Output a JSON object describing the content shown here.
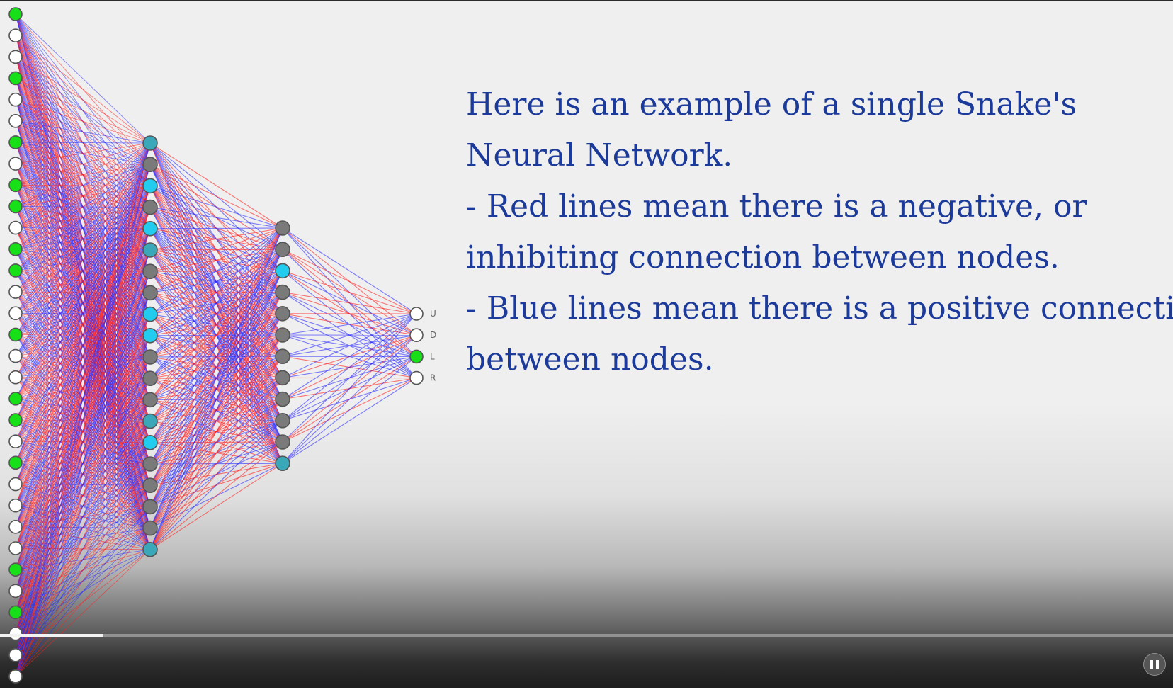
{
  "caption": {
    "line1": "Here is an example of a single Snake's",
    "line2": "Neural Network.",
    "line3": "- Red lines mean there is a negative, or",
    "line4": "inhibiting connection between nodes.",
    "line5": "- Blue lines mean there is a positive connection",
    "line6": "between nodes."
  },
  "network": {
    "layers": [
      {
        "name": "input",
        "active": [
          1,
          0,
          0,
          1,
          0,
          0,
          1,
          0,
          1,
          1,
          0,
          1,
          1,
          0,
          0,
          1,
          0,
          0,
          1,
          1,
          0,
          1,
          0,
          0,
          0,
          0,
          1,
          0,
          1,
          0,
          0,
          0
        ]
      },
      {
        "name": "hidden-1",
        "state": [
          "teal",
          "gray",
          "cyan",
          "gray",
          "cyan",
          "teal",
          "gray",
          "gray",
          "cyan",
          "cyan",
          "gray",
          "gray",
          "gray",
          "teal",
          "cyan",
          "gray",
          "gray",
          "gray",
          "gray",
          "teal"
        ]
      },
      {
        "name": "hidden-2",
        "state": [
          "gray",
          "gray",
          "cyan",
          "gray",
          "gray",
          "gray",
          "gray",
          "gray",
          "gray",
          "gray",
          "gray",
          "teal"
        ]
      },
      {
        "name": "output",
        "active": [
          0,
          0,
          1,
          0
        ],
        "labels": [
          "U",
          "D",
          "L",
          "R"
        ]
      }
    ],
    "colors": {
      "negative": "#ff2020",
      "positive": "#2a2aff",
      "active": "#18e018",
      "inactive": "#ffffff",
      "hidden_gray": "#7a7a7a",
      "hidden_cyan": "#22ccee",
      "hidden_teal": "#3aa8b8"
    }
  },
  "player": {
    "progress": 0.088,
    "state_icon": "pause-icon"
  }
}
